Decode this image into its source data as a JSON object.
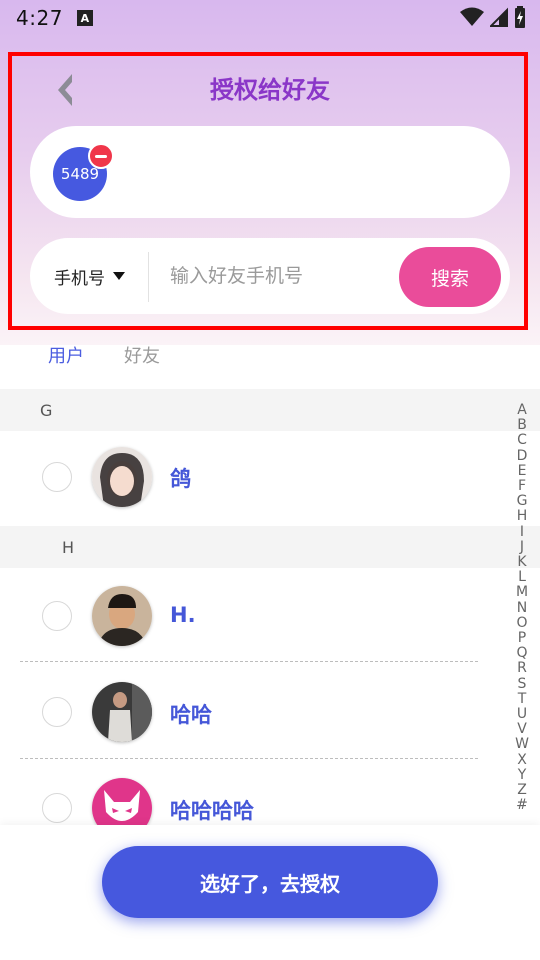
{
  "status_bar": {
    "time": "4:27",
    "notification_letter": "A"
  },
  "header": {
    "title": "授权给好友"
  },
  "selected": {
    "chips": [
      {
        "label": "5489"
      }
    ]
  },
  "search": {
    "type_label": "手机号",
    "placeholder": "输入好友手机号",
    "button_label": "搜索"
  },
  "tabs": [
    {
      "label": "用户",
      "active": true
    },
    {
      "label": "好友",
      "active": false
    }
  ],
  "sections": [
    {
      "letter": "G",
      "users": [
        {
          "name": "鸽"
        }
      ]
    },
    {
      "letter": "H",
      "users": [
        {
          "name": "H."
        },
        {
          "name": "哈哈"
        },
        {
          "name": "哈哈哈哈"
        }
      ]
    }
  ],
  "alphabet": [
    "A",
    "B",
    "C",
    "D",
    "E",
    "F",
    "G",
    "H",
    "I",
    "J",
    "K",
    "L",
    "M",
    "N",
    "O",
    "P",
    "Q",
    "R",
    "S",
    "T",
    "U",
    "V",
    "W",
    "X",
    "Y",
    "Z",
    "#"
  ],
  "footer": {
    "confirm_label": "选好了，去授权"
  },
  "colors": {
    "accent": "#4658de",
    "search_button": "#ea4c9a",
    "title": "#8a36c8",
    "highlight_box": "#ff0000"
  }
}
